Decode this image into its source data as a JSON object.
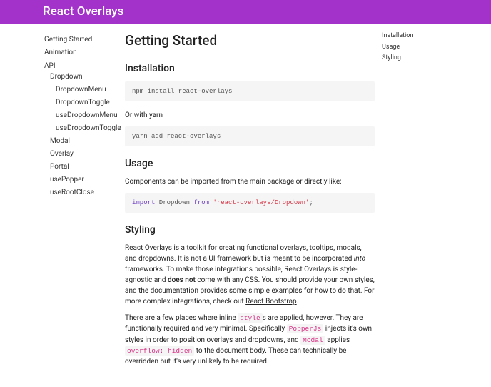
{
  "header": {
    "title": "React Overlays"
  },
  "leftNav": {
    "items": [
      {
        "label": "Getting Started",
        "indent": 0
      },
      {
        "label": "Animation",
        "indent": 0
      }
    ],
    "apiHeading": "API",
    "apiItems": [
      {
        "label": "Dropdown",
        "indent": 1
      },
      {
        "label": "DropdownMenu",
        "indent": 2
      },
      {
        "label": "DropdownToggle",
        "indent": 2
      },
      {
        "label": "useDropdownMenu",
        "indent": 2
      },
      {
        "label": "useDropdownToggle",
        "indent": 2
      },
      {
        "label": "Modal",
        "indent": 1
      },
      {
        "label": "Overlay",
        "indent": 1
      },
      {
        "label": "Portal",
        "indent": 1
      },
      {
        "label": "usePopper",
        "indent": 1
      },
      {
        "label": "useRootClose",
        "indent": 1
      }
    ]
  },
  "rightToc": {
    "items": [
      {
        "label": "Installation"
      },
      {
        "label": "Usage"
      },
      {
        "label": "Styling"
      }
    ]
  },
  "page": {
    "title": "Getting Started",
    "installation": {
      "heading": "Installation",
      "npmCmd": "npm install react-overlays",
      "orWithYarn": "Or with yarn",
      "yarnCmd": "yarn add react-overlays"
    },
    "usage": {
      "heading": "Usage",
      "intro": "Components can be imported from the main package or directly like:",
      "importCode": {
        "kw1": "import",
        "name": " Dropdown ",
        "kw2": "from",
        "sp": " ",
        "str": "'react-overlays/Dropdown'",
        "semi": ";"
      }
    },
    "styling": {
      "heading": "Styling",
      "p1_a": "React Overlays is a toolkit for creating functional overlays, tooltips, modals, and dropdowns. It is not a UI framework but is meant to be incorporated ",
      "p1_em": "into",
      "p1_b": " frameworks. To make those integrations possible, React Overlays is style-agnostic and ",
      "p1_strong": "does not",
      "p1_c": " come with any CSS. You should provide your own styles, and the documentation provides some simple examples for how to do that. For more complex integrations, check out ",
      "p1_link": "React Bootstrap",
      "p1_d": ".",
      "p2_a": "There are a few places where inline ",
      "p2_code1": "style",
      "p2_b": "s are applied, however. They are functionally required and very minimal. Specifically ",
      "p2_code2": "PopperJs",
      "p2_c": " injects it's own styles in order to position overlays and dropdowns, and ",
      "p2_code3": "Modal",
      "p2_d": " applies ",
      "p2_code4": "overflow: hidden",
      "p2_e": " to the document body. These can technically be overridden but it's very unlikely to be required."
    }
  }
}
